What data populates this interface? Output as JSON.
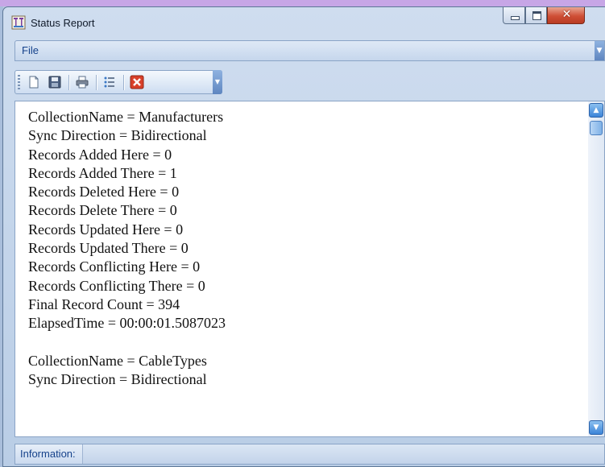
{
  "window": {
    "title": "Status Report",
    "icon": "app-status-icon",
    "controls": {
      "minimize": "minimize-icon",
      "maximize": "maximize-icon",
      "close": "close-icon"
    }
  },
  "menu": {
    "file_label": "File"
  },
  "toolbar": {
    "buttons": [
      "new-document-icon",
      "save-icon",
      "print-icon",
      "list-icon",
      "close-report-icon"
    ]
  },
  "report": {
    "lines": [
      "CollectionName = Manufacturers",
      "Sync Direction = Bidirectional",
      "Records Added Here = 0",
      "Records Added There = 1",
      "Records Deleted Here = 0",
      "Records Delete There = 0",
      "Records Updated Here = 0",
      "Records Updated There = 0",
      "Records Conflicting Here = 0",
      "Records Conflicting There = 0",
      "Final Record Count = 394",
      "ElapsedTime = 00:00:01.5087023",
      "",
      "CollectionName = CableTypes",
      "Sync Direction = Bidirectional"
    ]
  },
  "status": {
    "label": "Information:"
  },
  "colors": {
    "accent": "#15428b",
    "close_button": "#cf4f36",
    "scroll": "#3c84d8"
  }
}
